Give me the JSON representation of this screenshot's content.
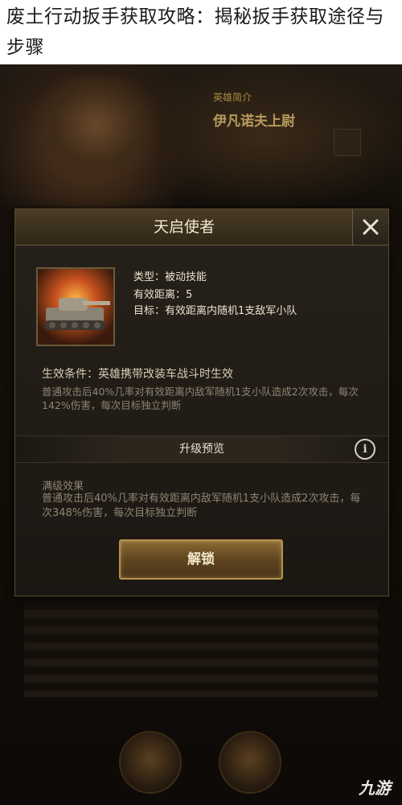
{
  "article": {
    "title": "废土行动扳手获取攻略：揭秘扳手获取途径与步骤"
  },
  "background": {
    "hero_label_small": "英雄简介",
    "hero_name": "伊凡诺夫上尉",
    "watermark": "九游"
  },
  "dialog": {
    "title": "天启使者",
    "skill": {
      "type": "类型：被动技能",
      "range": "有效距离：5",
      "target": "目标：有效距离内随机1支敌军小队"
    },
    "condition": "生效条件：英雄携带改装车战斗时生效",
    "description": "普通攻击后40%几率对有效距离内敌军随机1支小队造成2次攻击，每次142%伤害，每次目标独立判断",
    "upgrade_section": "升级预览",
    "max_effect_title": "满级效果",
    "max_effect_desc": "普通攻击后40%几率对有效距离内敌军随机1支小队造成2次攻击，每次348%伤害，每次目标独立判断",
    "unlock_label": "解锁"
  },
  "icons": {
    "close": "close-icon",
    "info": "info-icon",
    "skill": "tank-icon"
  }
}
